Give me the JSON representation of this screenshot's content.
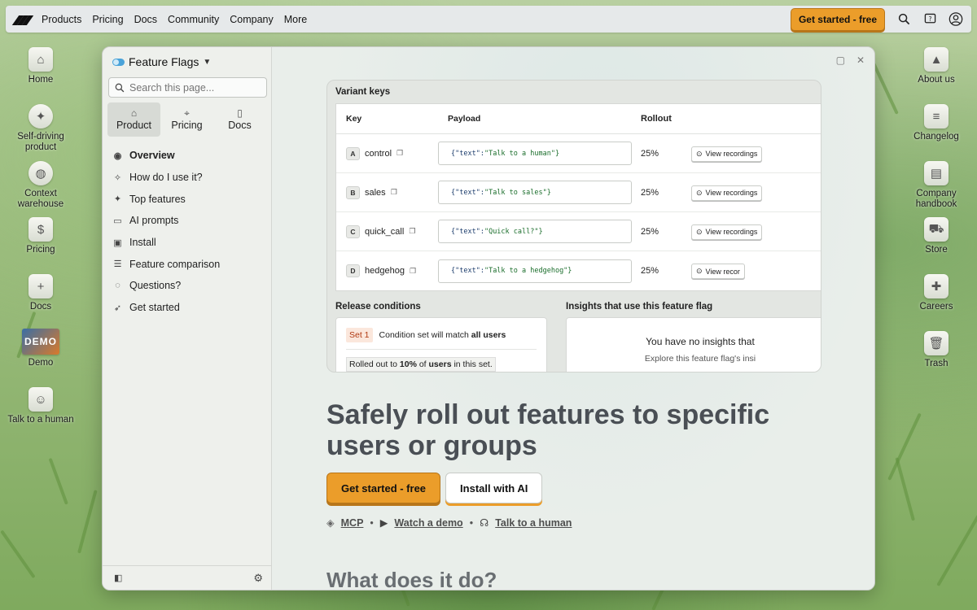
{
  "topnav": {
    "items": [
      "Products",
      "Pricing",
      "Docs",
      "Community",
      "Company",
      "More"
    ],
    "cta": "Get started - free"
  },
  "desktop_left": [
    {
      "label": "Home",
      "icon": "home-icon"
    },
    {
      "label": "Self-driving product",
      "icon": "brain-icon"
    },
    {
      "label": "Context warehouse",
      "icon": "globe-icon"
    },
    {
      "label": "Pricing",
      "icon": "pricing-icon"
    },
    {
      "label": "Docs",
      "icon": "docs-icon"
    },
    {
      "label": "Demo",
      "icon": "demo-icon",
      "badge": "DEMO"
    },
    {
      "label": "Talk to a human",
      "icon": "human-icon"
    }
  ],
  "desktop_right": [
    {
      "label": "About us",
      "icon": "about-icon"
    },
    {
      "label": "Changelog",
      "icon": "changelog-icon"
    },
    {
      "label": "Company handbook",
      "icon": "handbook-icon"
    },
    {
      "label": "Store",
      "icon": "store-icon"
    },
    {
      "label": "Careers",
      "icon": "careers-icon"
    },
    {
      "label": "Trash",
      "icon": "trash-icon"
    }
  ],
  "sidebar": {
    "title": "Feature Flags",
    "search_placeholder": "Search this page...",
    "tabs": [
      "Product",
      "Pricing",
      "Docs"
    ],
    "menu": [
      "Overview",
      "How do I use it?",
      "Top features",
      "AI prompts",
      "Install",
      "Feature comparison",
      "Questions?",
      "Get started"
    ]
  },
  "card": {
    "variant_title": "Variant keys",
    "columns": [
      "Key",
      "Payload",
      "Rollout"
    ],
    "rows": [
      {
        "badge": "A",
        "key": "control",
        "payload_key": "{\"text\":",
        "payload_val": "\"Talk to a human\"}",
        "rollout": "25%",
        "action": "View recordings"
      },
      {
        "badge": "B",
        "key": "sales",
        "payload_key": "{\"text\":",
        "payload_val": "\"Talk to sales\"}",
        "rollout": "25%",
        "action": "View recordings"
      },
      {
        "badge": "C",
        "key": "quick_call",
        "payload_key": "{\"text\":",
        "payload_val": "\"Quick call?\"}",
        "rollout": "25%",
        "action": "View recordings"
      },
      {
        "badge": "D",
        "key": "hedgehog",
        "payload_key": "{\"text\":",
        "payload_val": "\"Talk to a hedgehog\"}",
        "rollout": "25%",
        "action": "View recor"
      }
    ],
    "release_title": "Release conditions",
    "set_badge": "Set 1",
    "condition_prefix": "Condition set will match",
    "condition_bold": "all users",
    "rolled_prefix": "Rolled out to",
    "rolled_pct": "10%",
    "rolled_mid": "of",
    "rolled_users": "users",
    "rolled_suffix": "in this set.",
    "insights_title": "Insights that use this feature flag",
    "insights_empty": "You have no insights that",
    "insights_sub": "Explore this feature flag's insi"
  },
  "hero": {
    "title": "Safely roll out features to specific users or groups",
    "primary": "Get started - free",
    "secondary": "Install with AI",
    "links": [
      "MCP",
      "Watch a demo",
      "Talk to a human"
    ],
    "next_title": "What does it do?"
  },
  "colors": {
    "accent": "#eb9d2a",
    "accent_dark": "#b8761a",
    "flag_blue": "#4aa3d9"
  }
}
